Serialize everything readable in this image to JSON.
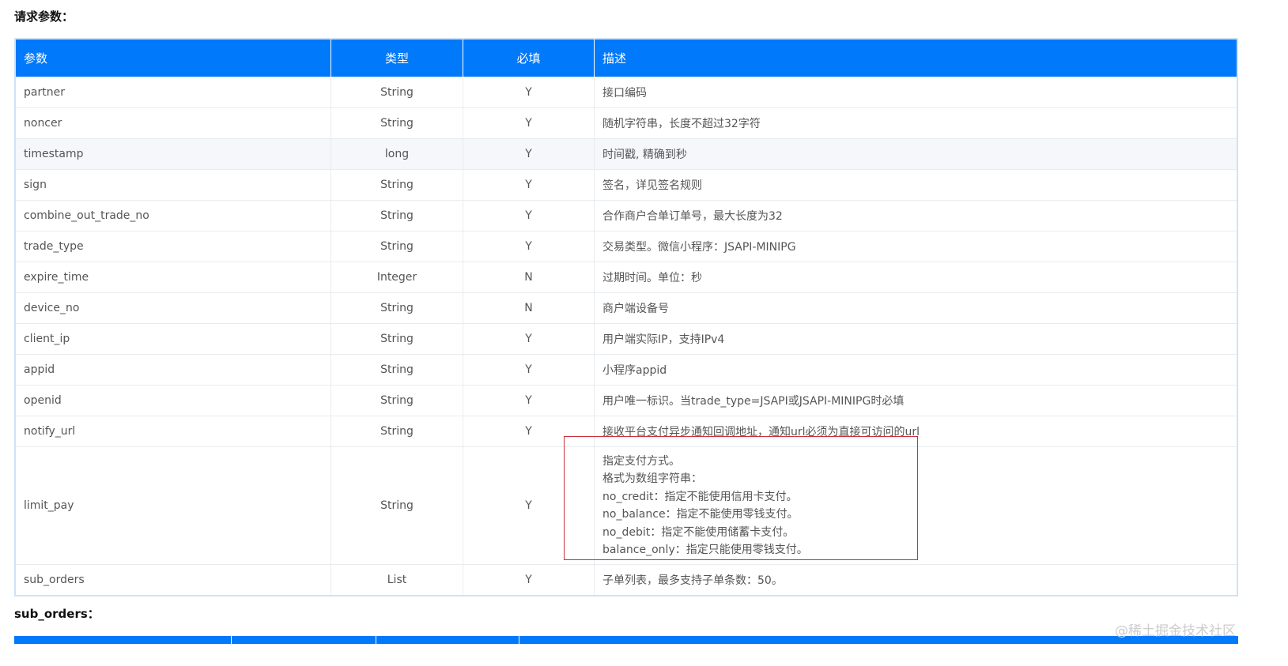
{
  "heading": "请求参数：",
  "headers": [
    "参数",
    "类型",
    "必填",
    "描述"
  ],
  "rows": [
    [
      "partner",
      "String",
      "Y",
      "接口编码"
    ],
    [
      "noncer",
      "String",
      "Y",
      "随机字符串，长度不超过32字符"
    ],
    [
      "timestamp",
      "long",
      "Y",
      "时间戳, 精确到秒"
    ],
    [
      "sign",
      "String",
      "Y",
      "签名，详见签名规则"
    ],
    [
      "combine_out_trade_no",
      "String",
      "Y",
      "合作商户合单订单号，最大长度为32"
    ],
    [
      "trade_type",
      "String",
      "Y",
      "交易类型。微信小程序：JSAPI-MINIPG"
    ],
    [
      "expire_time",
      "Integer",
      "N",
      "过期时间。单位：秒"
    ],
    [
      "device_no",
      "String",
      "N",
      "商户端设备号"
    ],
    [
      "client_ip",
      "String",
      "Y",
      "用户端实际IP，支持IPv4"
    ],
    [
      "appid",
      "String",
      "Y",
      "小程序appid"
    ],
    [
      "openid",
      "String",
      "Y",
      "用户唯一标识。当trade_type=JSAPI或JSAPI-MINIPG时必填"
    ],
    [
      "notify_url",
      "String",
      "Y",
      "接收平台支付异步通知回调地址，通知url必须为直接可访问的url"
    ]
  ],
  "limit_pay": {
    "name": "limit_pay",
    "type": "String",
    "req": "Y",
    "lines": [
      "指定支付方式。",
      "格式为数组字符串：",
      "no_credit：指定不能使用信用卡支付。",
      "no_balance：指定不能使用零钱支付。",
      "no_debit：指定不能使用储蓄卡支付。",
      "balance_only：指定只能使用零钱支付。"
    ]
  },
  "sub_orders_row": [
    "sub_orders",
    "List",
    "Y",
    "子单列表，最多支持子单条数：50。"
  ],
  "heading2": "sub_orders：",
  "watermark": "@稀土掘金技术社区"
}
